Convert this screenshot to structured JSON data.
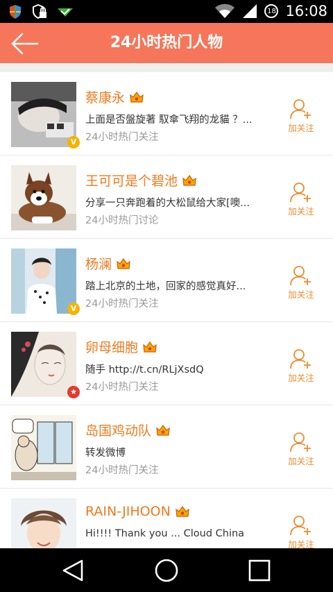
{
  "status_bar": {
    "time": "16:08",
    "battery": "18",
    "icons": [
      "shield-icon",
      "lock-shield-icon",
      "download-check-icon",
      "wifi-icon",
      "signal-icon",
      "battery-icon"
    ]
  },
  "header": {
    "title": "24小时热门人物",
    "back_icon": "back-arrow-icon",
    "color": "#f5765a"
  },
  "people": [
    {
      "name": "蔡康永",
      "desc": "上面是否盤旋著 馭傘飞翔的龙貓 ？...",
      "tag": "24小时热门关注",
      "badge": "V",
      "follow_label": "加关注"
    },
    {
      "name": "王可可是个碧池",
      "desc": "分享一只奔跑着的大松鼠给大家[噢...",
      "tag": "24小时热门讨论",
      "badge": "",
      "follow_label": "加关注"
    },
    {
      "name": "杨澜",
      "desc": "踏上北京的土地，回家的感觉真好...",
      "tag": "24小时热门关注",
      "badge": "V",
      "follow_label": "加关注"
    },
    {
      "name": "卵母细胞",
      "desc": "随手 http://t.cn/RLjXsdQ",
      "tag": "24小时热门关注",
      "badge": "★",
      "follow_label": "加关注"
    },
    {
      "name": "岛国鸡动队",
      "desc": "转发微博",
      "tag": "24小时热门关注",
      "badge": "",
      "follow_label": "加关注"
    },
    {
      "name": "RAIN-JIHOON",
      "desc": "Hi!!!! Thank you ... Cloud China",
      "tag": "",
      "badge": "",
      "follow_label": "加关注"
    }
  ],
  "accent_colors": {
    "name": "#f07b1e",
    "follow": "#f08a2a",
    "verified": "#f5b400",
    "star": "#e23b2e"
  },
  "nav": {
    "icons": [
      "back-triangle-icon",
      "home-circle-icon",
      "recents-square-icon"
    ]
  }
}
